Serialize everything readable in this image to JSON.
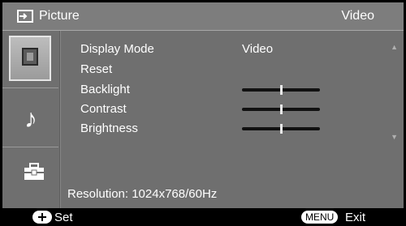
{
  "header": {
    "icon": "input-source-icon",
    "title": "Picture",
    "mode": "Video"
  },
  "sidebar": {
    "items": [
      {
        "name": "picture",
        "icon": "picture-icon",
        "selected": true
      },
      {
        "name": "sound",
        "icon": "music-note-icon",
        "selected": false
      },
      {
        "name": "setup",
        "icon": "toolbox-icon",
        "selected": false
      }
    ]
  },
  "menu": {
    "items": [
      {
        "label": "Display Mode",
        "value": "Video"
      },
      {
        "label": "Reset"
      },
      {
        "label": "Backlight",
        "level": 0.5
      },
      {
        "label": "Contrast",
        "level": 0.5
      },
      {
        "label": "Brightness",
        "level": 0.5
      }
    ],
    "resolution": "Resolution: 1024x768/60Hz"
  },
  "footer": {
    "set_label": "Set",
    "menu_button": "MENU",
    "exit_label": "Exit"
  },
  "colors": {
    "panel": "#6f6f6f",
    "titlebar": "#7d7d7d",
    "background": "#000000"
  }
}
